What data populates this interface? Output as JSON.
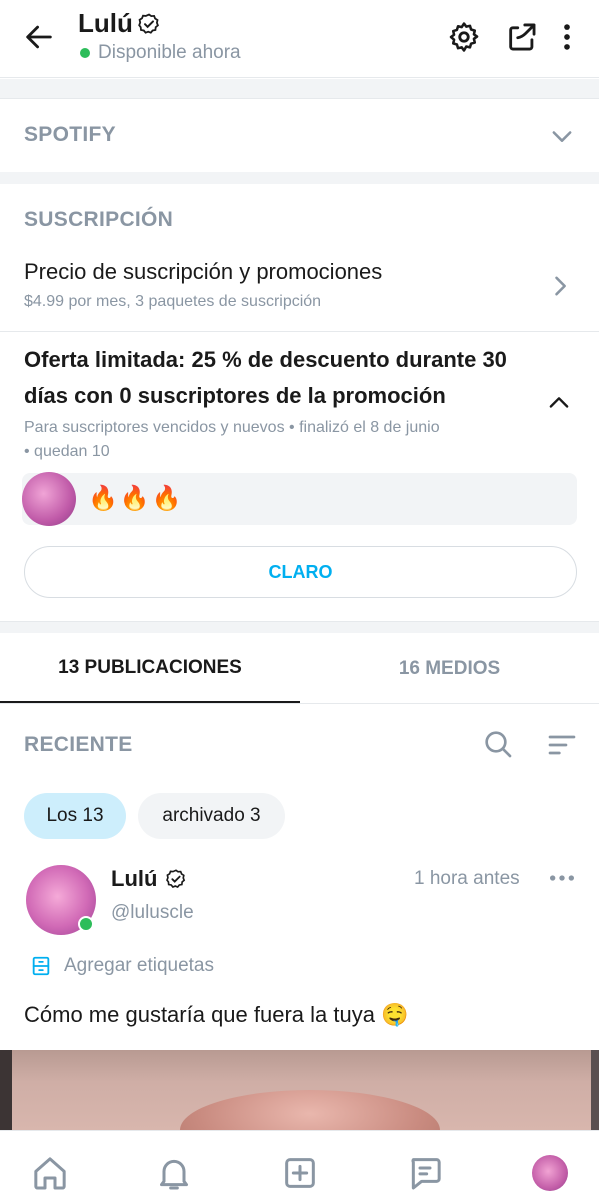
{
  "header": {
    "name": "Lulú",
    "status": "Disponible ahora",
    "icons": [
      "back-arrow-icon",
      "verified-icon",
      "gear-icon",
      "share-icon",
      "more-vertical-icon"
    ]
  },
  "spotify": {
    "title": "SPOTIFY"
  },
  "subscription": {
    "section_title": "SUSCRIPCIÓN",
    "price_title": "Precio de suscripción y promociones",
    "price_sub": "$4.99 por mes, 3 paquetes de suscripción"
  },
  "offer": {
    "title": "Oferta limitada: 25 % de descuento durante 30 días con 0 suscriptores de la promoción",
    "meta": "Para suscriptores vencidos y nuevos • finalizó el 8 de junio • quedan 10",
    "message": "🔥🔥🔥",
    "button": "CLARO"
  },
  "tabs": [
    {
      "label": "13 PUBLICACIONES",
      "active": true
    },
    {
      "label": "16 MEDIOS",
      "active": false
    }
  ],
  "feed": {
    "sort_label": "RECIENTE",
    "chips": [
      {
        "label": "Los 13",
        "active": true
      },
      {
        "label": "archivado 3",
        "active": false
      }
    ]
  },
  "post": {
    "name": "Lulú",
    "handle": "@luluscle",
    "time": "1 hora antes",
    "tags_label": "Agregar etiquetas",
    "text": "Cómo me gustaría que fuera la tuya 🤤"
  },
  "bottom_nav": [
    "home-icon",
    "bell-icon",
    "add-post-icon",
    "messages-icon",
    "profile-avatar"
  ],
  "colors": {
    "accent": "#00aff0",
    "muted": "#8a96a3",
    "online": "#2dbd5a",
    "chip_active": "#cdeefc"
  }
}
